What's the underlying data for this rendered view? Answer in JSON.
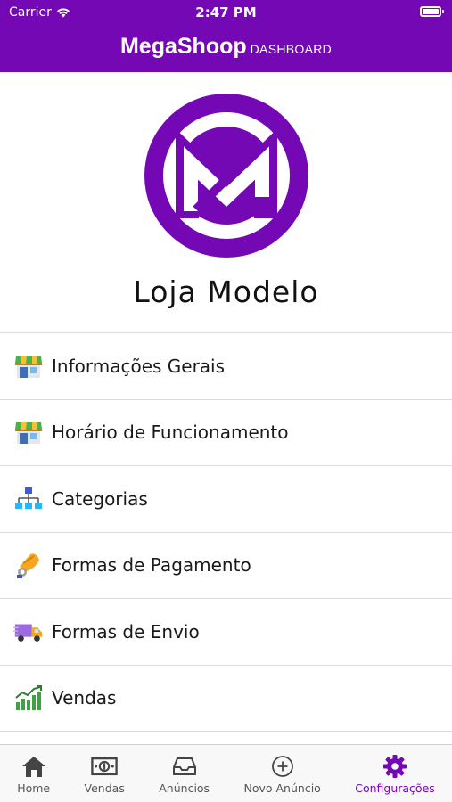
{
  "status_bar": {
    "carrier": "Carrier",
    "time": "2:47 PM"
  },
  "header": {
    "brand": "MegaShoop",
    "subtitle": "DASHBOARD",
    "color": "#7408b5"
  },
  "store": {
    "name": "Loja Modelo",
    "logo_icon": "megashoop-logo"
  },
  "menu": {
    "items": [
      {
        "label": "Informações Gerais",
        "icon": "store-icon"
      },
      {
        "label": "Horário de Funcionamento",
        "icon": "store-icon"
      },
      {
        "label": "Categorias",
        "icon": "hierarchy-icon"
      },
      {
        "label": "Formas de Pagamento",
        "icon": "payment-hand-icon"
      },
      {
        "label": "Formas de Envio",
        "icon": "delivery-truck-icon"
      },
      {
        "label": "Vendas",
        "icon": "sales-chart-icon"
      }
    ]
  },
  "tabbar": {
    "tabs": [
      {
        "label": "Home",
        "icon": "home-icon"
      },
      {
        "label": "Vendas",
        "icon": "money-icon"
      },
      {
        "label": "Anúncios",
        "icon": "inbox-icon"
      },
      {
        "label": "Novo Anúncio",
        "icon": "plus-circle-icon"
      },
      {
        "label": "Configurações",
        "icon": "gear-icon",
        "active": true
      }
    ],
    "active_color": "#7408b5"
  }
}
